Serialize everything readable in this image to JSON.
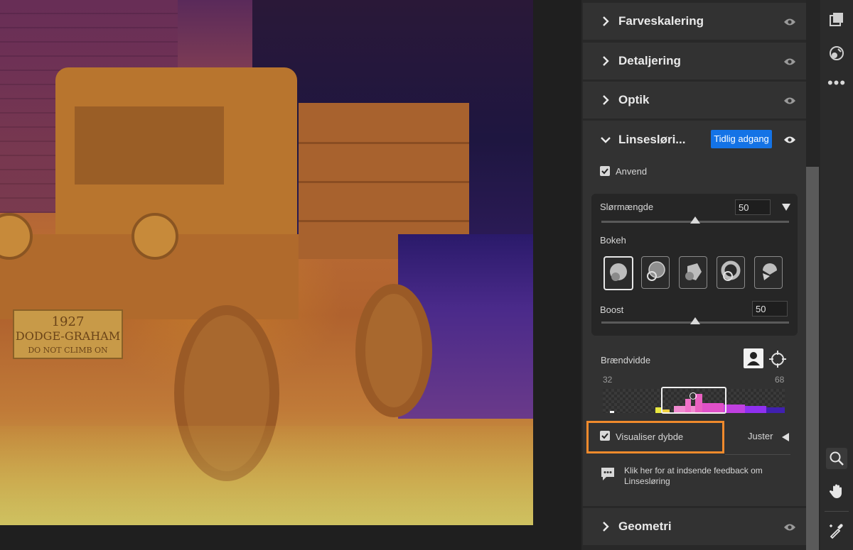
{
  "canvas": {
    "plate_line1": "1927",
    "plate_line2": "DODGE-GRAHAM",
    "plate_line3": "DO NOT CLIMB ON"
  },
  "panel": {
    "sections_top": [
      {
        "label": "Farveskalering",
        "icon": "chevron-right-icon"
      },
      {
        "label": "Detaljering",
        "icon": "chevron-right-icon"
      },
      {
        "label": "Optik",
        "icon": "chevron-right-icon"
      }
    ],
    "lens": {
      "title": "Linsesløri...",
      "badge": "Tidlig adgang",
      "apply_label": "Anvend",
      "apply_checked": true,
      "blur_label": "Slørmængde",
      "blur_value": "50",
      "blur_level": 0.5,
      "bokeh_label": "Bokeh",
      "bokeh_selected_index": 0,
      "boost_label": "Boost",
      "boost_value": "50",
      "boost_level": 0.5,
      "focal_label": "Brændvidde",
      "range_min": "32",
      "range_max": "68",
      "visualize_label": "Visualiser dybde",
      "visualize_checked": true,
      "adjust_label": "Juster",
      "feedback_text": "Klik her for at indsende feedback om Linsesløring"
    },
    "section_bottom": {
      "label": "Geometri",
      "icon": "chevron-right-icon"
    }
  },
  "colors": {
    "accent": "#1473e6",
    "highlight": "#f08a2c"
  }
}
